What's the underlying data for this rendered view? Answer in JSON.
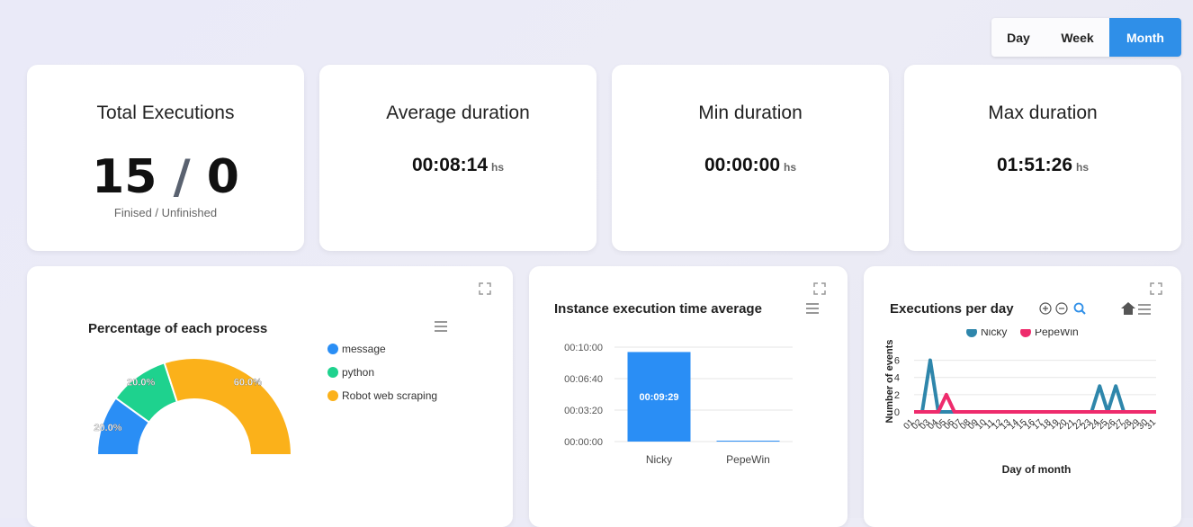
{
  "range_buttons": {
    "day": "Day",
    "week": "Week",
    "month": "Month"
  },
  "stats": {
    "total": {
      "title": "Total Executions",
      "finished": "15",
      "unfinished": "0",
      "sep": "/",
      "caption": "Finised / Unfinished"
    },
    "average": {
      "title": "Average duration",
      "value": "00:08:14",
      "unit": "hs"
    },
    "min": {
      "title": "Min duration",
      "value": "00:00:00",
      "unit": "hs"
    },
    "max": {
      "title": "Max duration",
      "value": "01:51:26",
      "unit": "hs"
    }
  },
  "charts": {
    "process": {
      "title": "Percentage of each process"
    },
    "instance": {
      "title": "Instance execution time average"
    },
    "perday": {
      "title": "Executions per day"
    }
  },
  "colors": {
    "blue": "#2a8ef5",
    "green": "#1ed28e",
    "orange": "#fbb11a",
    "teal": "#2e86ab",
    "pink": "#ee2b6c",
    "accent": "#2f8fe8"
  },
  "chart_data": [
    {
      "type": "pie",
      "title": "Percentage of each process",
      "variant": "semi-donut",
      "categories": [
        "message",
        "python",
        "Robot web scraping"
      ],
      "values": [
        20.0,
        20.0,
        60.0
      ],
      "labels": [
        "20.0%",
        "20.0%",
        "60.0%"
      ],
      "legend": "right"
    },
    {
      "type": "bar",
      "title": "Instance execution time average",
      "categories": [
        "Nicky",
        "PepeWin"
      ],
      "values": [
        569,
        0
      ],
      "data_labels": [
        "00:09:29",
        ""
      ],
      "yticks": [
        "00:00:00",
        "00:03:20",
        "00:06:40",
        "00:10:00"
      ],
      "ylim": [
        0,
        600
      ]
    },
    {
      "type": "line",
      "title": "Executions per day",
      "xlabel": "Day of month",
      "ylabel": "Number of events",
      "x": [
        "01",
        "02",
        "03",
        "04",
        "05",
        "06",
        "07",
        "08",
        "09",
        "10",
        "11",
        "12",
        "13",
        "14",
        "15",
        "16",
        "17",
        "18",
        "19",
        "20",
        "21",
        "22",
        "23",
        "24",
        "25",
        "26",
        "27",
        "28",
        "29",
        "30",
        "31"
      ],
      "series": [
        {
          "name": "Nicky",
          "values": [
            0,
            0,
            6,
            0,
            0,
            0,
            0,
            0,
            0,
            0,
            0,
            0,
            0,
            0,
            0,
            0,
            0,
            0,
            0,
            0,
            0,
            0,
            0,
            3,
            0,
            3,
            0,
            0,
            0,
            0,
            0
          ]
        },
        {
          "name": "PepeWin",
          "values": [
            0,
            0,
            0,
            0,
            2,
            0,
            0,
            0,
            0,
            0,
            0,
            0,
            0,
            0,
            0,
            0,
            0,
            0,
            0,
            0,
            0,
            0,
            0,
            0,
            0,
            0,
            0,
            0,
            0,
            0,
            0
          ]
        }
      ],
      "yticks": [
        "0",
        "2",
        "4",
        "6"
      ],
      "ylim": [
        0,
        7
      ],
      "legend": "top"
    }
  ]
}
